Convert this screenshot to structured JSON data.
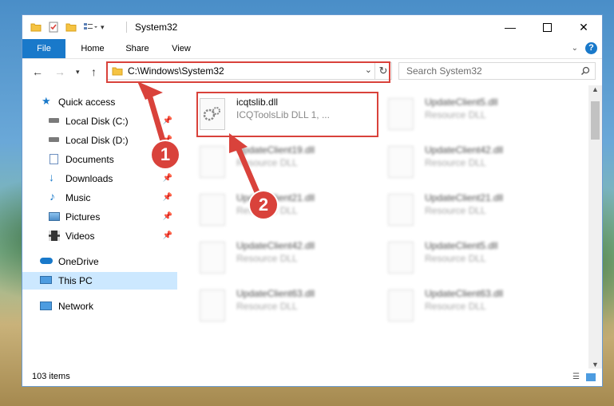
{
  "window": {
    "title": "System32"
  },
  "ribbon": {
    "tabs": [
      "File",
      "Home",
      "Share",
      "View"
    ],
    "help": "?"
  },
  "address": {
    "path": "C:\\Windows\\System32"
  },
  "search": {
    "placeholder": "Search System32"
  },
  "sidebar": {
    "items": [
      {
        "label": "Quick access",
        "icon": "star-icon",
        "pinned": false
      },
      {
        "label": "Local Disk (C:)",
        "icon": "drive-icon",
        "pinned": true
      },
      {
        "label": "Local Disk (D:)",
        "icon": "drive-icon",
        "pinned": true
      },
      {
        "label": "Documents",
        "icon": "documents-icon",
        "pinned": true
      },
      {
        "label": "Downloads",
        "icon": "download-arrow-icon",
        "pinned": true
      },
      {
        "label": "Music",
        "icon": "music-note-icon",
        "pinned": true
      },
      {
        "label": "Pictures",
        "icon": "pictures-icon",
        "pinned": true
      },
      {
        "label": "Videos",
        "icon": "film-icon",
        "pinned": true
      },
      {
        "label": "OneDrive",
        "icon": "cloud-icon",
        "pinned": false
      },
      {
        "label": "This PC",
        "icon": "monitor-icon",
        "pinned": false,
        "selected": true
      },
      {
        "label": "Network",
        "icon": "network-icon",
        "pinned": false
      }
    ]
  },
  "files": [
    {
      "name": "icqtslib.dll",
      "type": "ICQToolsLib DLL 1, ...",
      "highlighted": true
    },
    {
      "name": "UpdateClient5.dll",
      "type": "Resource DLL"
    },
    {
      "name": "UpdateClient19.dll",
      "type": "Resource DLL"
    },
    {
      "name": "UpdateClient42.dll",
      "type": "Resource DLL"
    },
    {
      "name": "UpdateClient21.dll",
      "type": "Resource DLL"
    },
    {
      "name": "UpdateClient21.dll",
      "type": "Resource DLL"
    },
    {
      "name": "UpdateClient42.dll",
      "type": "Resource DLL"
    },
    {
      "name": "UpdateClient5.dll",
      "type": "Resource DLL"
    },
    {
      "name": "UpdateClient63.dll",
      "type": "Resource DLL"
    },
    {
      "name": "UpdateClient63.dll",
      "type": "Resource DLL"
    }
  ],
  "status": {
    "count": "103 items"
  },
  "callouts": [
    "1",
    "2"
  ],
  "colors": {
    "accent": "#1979ca",
    "highlight": "#d9423b",
    "selected": "#cce8ff"
  }
}
